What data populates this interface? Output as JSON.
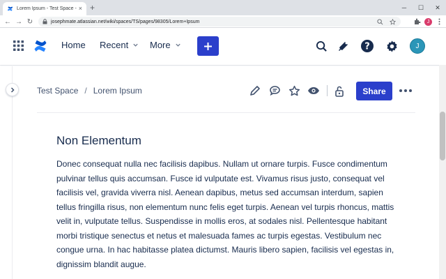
{
  "browser": {
    "tab_title": "Lorem Ipsum - Test Space - Conf",
    "url": "josephmate.atlassian.net/wiki/spaces/TS/pages/98305/Lorem+Ipsum",
    "profile_initial": "J"
  },
  "header": {
    "home": "Home",
    "recent": "Recent",
    "more": "More",
    "avatar_initial": "J"
  },
  "breadcrumb": {
    "space": "Test Space",
    "separator": "/",
    "page": "Lorem Ipsum"
  },
  "actions": {
    "share": "Share"
  },
  "content": {
    "heading": "Non Elementum",
    "paragraph": "Donec consequat nulla nec facilisis dapibus. Nullam ut ornare turpis. Fusce condimentum pulvinar tellus quis accumsan. Fusce id vulputate est. Vivamus risus justo, consequat vel facilisis vel, gravida viverra nisl. Aenean dapibus, metus sed accumsan interdum, sapien tellus fringilla risus, non elementum nunc felis eget turpis. Aenean vel turpis rhoncus, mattis velit in, vulputate tellus. Suspendisse in mollis eros, at sodales nisl. Pellentesque habitant morbi tristique senectus et netus et malesuada fames ac turpis egestas. Vestibulum nec congue urna. In hac habitasse platea dictumst. Mauris libero sapien, facilisis vel egestas in, dignissim blandit augue."
  },
  "icons": {
    "app_switcher": "grid-icon",
    "logo": "confluence-logo-icon",
    "create": "plus-icon",
    "search": "search-icon",
    "notifications": "megaphone-icon",
    "help": "help-icon",
    "settings": "gear-icon",
    "edit": "pencil-icon",
    "comment": "comment-icon",
    "star": "star-icon",
    "watch": "eye-icon",
    "restrictions": "unlock-icon",
    "more": "more-icon"
  },
  "colors": {
    "brand": "#2b3fcb",
    "avatar": "#2b96b8",
    "text": "#172b4d"
  }
}
